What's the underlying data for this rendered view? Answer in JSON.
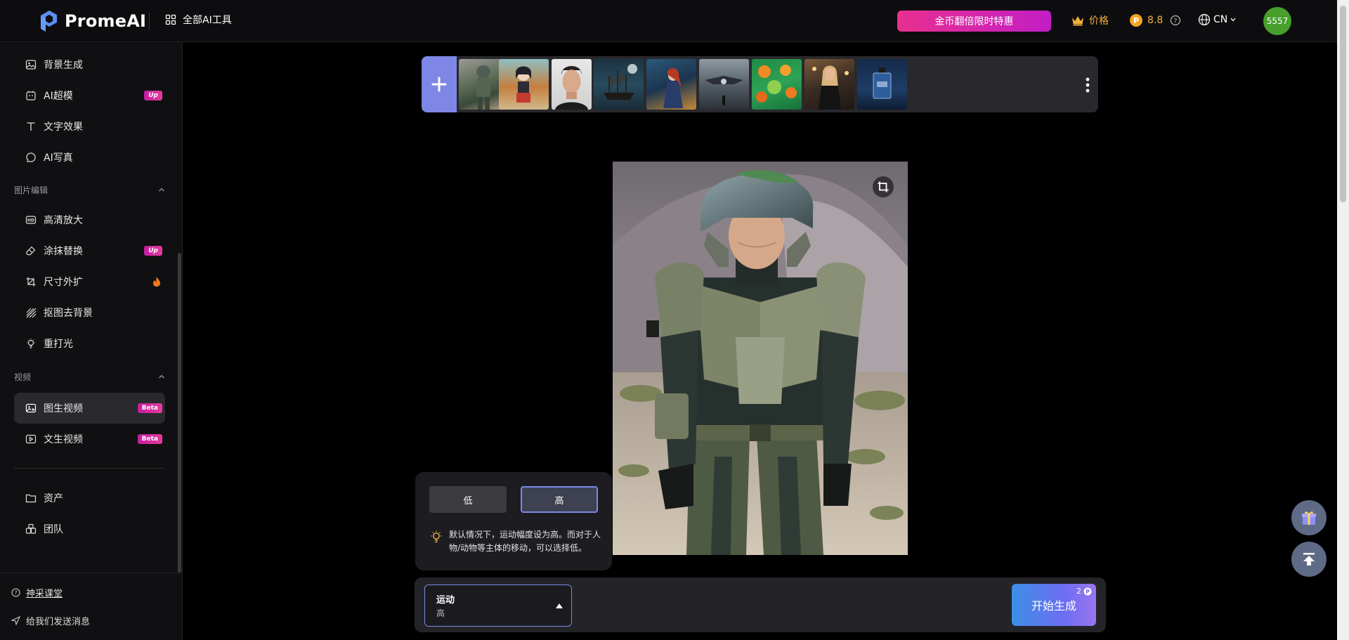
{
  "header": {
    "logo_text": "PromeAI",
    "all_tools": "全部AI工具",
    "promo": "金币翻倍限时特惠",
    "price": "价格",
    "coins": "8.8",
    "language": "CN",
    "avatar": "5557"
  },
  "sidebar": {
    "items_top": [
      {
        "label": "背景生成",
        "icon": "image-icon"
      },
      {
        "label": "AI超模",
        "icon": "model-icon",
        "badge": "Up"
      },
      {
        "label": "文字效果",
        "icon": "text-icon"
      },
      {
        "label": "AI写真",
        "icon": "portrait-icon"
      }
    ],
    "section_image_edit": "图片编辑",
    "items_edit": [
      {
        "label": "高清放大",
        "icon": "hd-icon"
      },
      {
        "label": "涂抹替换",
        "icon": "eraser-icon",
        "badge": "Up"
      },
      {
        "label": "尺寸外扩",
        "icon": "crop-expand-icon",
        "badge": "fire-icon"
      },
      {
        "label": "抠图去背景",
        "icon": "stripes-icon"
      },
      {
        "label": "重打光",
        "icon": "bulb-icon"
      }
    ],
    "section_video": "视频",
    "items_video": [
      {
        "label": "图生视频",
        "icon": "image-video-icon",
        "badge": "Beta"
      },
      {
        "label": "文生视频",
        "icon": "play-icon",
        "badge": "Beta"
      }
    ],
    "items_bottom": [
      {
        "label": "资产",
        "icon": "folder-icon"
      },
      {
        "label": "团队",
        "icon": "team-icon"
      }
    ],
    "footer": {
      "course": "神采课堂",
      "feedback": "给我们发送消息"
    }
  },
  "motion_popup": {
    "low": "低",
    "high": "高",
    "tip": "默认情况下，运动幅度设为高。而对于人物/动物等主体的移动，可以选择低。"
  },
  "bottom": {
    "motion_label": "运动",
    "motion_value": "高",
    "generate": "开始生成",
    "cost": "2"
  },
  "colors": {
    "accent": "#7e87e6",
    "brand_pink": "#e8308f",
    "gold": "#f2b13c",
    "avatar": "#46a02b"
  }
}
